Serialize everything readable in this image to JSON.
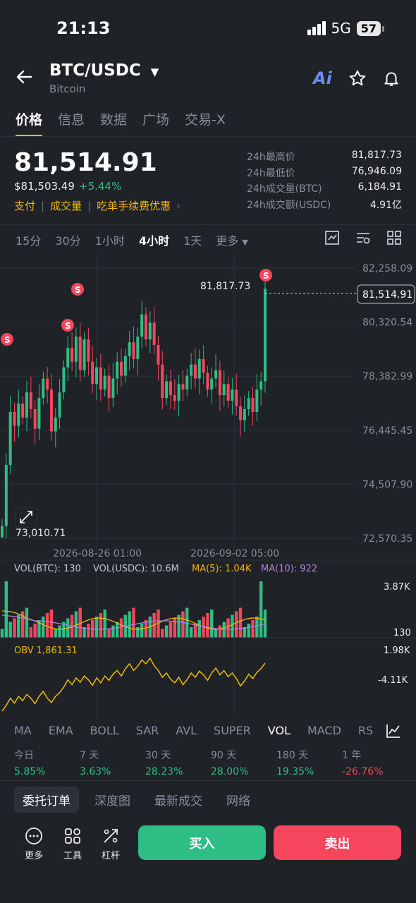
{
  "status_bar": {
    "time": "21:13",
    "network": "5G",
    "battery": "57"
  },
  "header": {
    "pair": "BTC/USDC",
    "name": "Bitcoin",
    "icons": [
      "back-arrow-icon",
      "ai-icon",
      "star-icon",
      "bell-icon"
    ],
    "ai_label": "Ai"
  },
  "tabs": [
    {
      "label": "价格",
      "active": true
    },
    {
      "label": "信息"
    },
    {
      "label": "数据"
    },
    {
      "label": "广场"
    },
    {
      "label": "交易-X"
    }
  ],
  "ticker": {
    "price": "81,514.91",
    "usd_price": "$81,503.49",
    "change_pct": "+5.44%",
    "promo": [
      "支付",
      "成交量",
      "吃单手续费优惠"
    ],
    "stats": [
      {
        "label": "24h最高价",
        "value": "81,817.73"
      },
      {
        "label": "24h最低价",
        "value": "76,946.09"
      },
      {
        "label": "24h成交量(BTC)",
        "value": "6,184.91"
      },
      {
        "label": "24h成交额(USDC)",
        "value": "4.91亿"
      }
    ]
  },
  "intervals": [
    "15分",
    "30分",
    "1小时",
    "4小时",
    "1天",
    "更多"
  ],
  "selected_interval": "4小时",
  "chart_data": {
    "type": "candlestick",
    "ylim": [
      72570.35,
      82258.09
    ],
    "y_ticks": [
      "82,258.09",
      "80,320.54",
      "78,382.99",
      "76,445.45",
      "74,507.90",
      "72,570.35"
    ],
    "x_ticks": [
      "2026-08-26 01:00",
      "2026-09-02 05:00"
    ],
    "current_price_label": "81,514.91",
    "high_marker": "81,817.73",
    "low_marker": "73,010.71",
    "close_series": [
      73010,
      75200,
      77100,
      76600,
      77400,
      76900,
      77800,
      77200,
      76500,
      77600,
      78300,
      77900,
      76400,
      76900,
      77800,
      78700,
      79400,
      78900,
      79800,
      78600,
      79700,
      78900,
      78100,
      78700,
      77900,
      78400,
      77600,
      78300,
      78900,
      78400,
      79100,
      79600,
      79000,
      79800,
      80600,
      79700,
      80300,
      79500,
      78800,
      77600,
      78200,
      77700,
      77500,
      78100,
      77900,
      78400,
      78800,
      78300,
      79000,
      78500,
      77900,
      78300,
      78600,
      77700,
      78100,
      77500,
      77900,
      77300,
      76800,
      77200,
      77600,
      77100,
      77900,
      78200,
      81514
    ],
    "volume": {
      "label_btc": "VOL(BTC): 130",
      "label_usdc": "VOL(USDC): 10.6M",
      "label_ma5": "MA(5): 1.04K",
      "label_ma10": "MA(10): 922",
      "y_top": "3.87K",
      "y_bottom": "130"
    },
    "obv": {
      "label": "OBV 1,861.31",
      "y_top": "1.98K",
      "y_mid": "-4.11K"
    }
  },
  "indicators": [
    "MA",
    "EMA",
    "BOLL",
    "SAR",
    "AVL",
    "SUPER",
    "VOL",
    "MACD",
    "RSI"
  ],
  "selected_indicator": "VOL",
  "performance": [
    {
      "label": "今日",
      "value": "5.85%",
      "dir": "up"
    },
    {
      "label": "7 天",
      "value": "3.63%",
      "dir": "up"
    },
    {
      "label": "30 天",
      "value": "28.23%",
      "dir": "up"
    },
    {
      "label": "90 天",
      "value": "28.00%",
      "dir": "up"
    },
    {
      "label": "180 天",
      "value": "19.35%",
      "dir": "up"
    },
    {
      "label": "1 年",
      "value": "-26.76%",
      "dir": "down"
    }
  ],
  "order_tabs": [
    "委托订单",
    "深度图",
    "最新成交",
    "网络"
  ],
  "bottom_bar": {
    "more": "更多",
    "tools": "工具",
    "leverage": "杠杆",
    "buy": "买入",
    "sell": "卖出"
  },
  "colors": {
    "up": "#2ebd85",
    "down": "#f6465d",
    "accent": "#f0b90b",
    "bg": "#1f2227"
  }
}
